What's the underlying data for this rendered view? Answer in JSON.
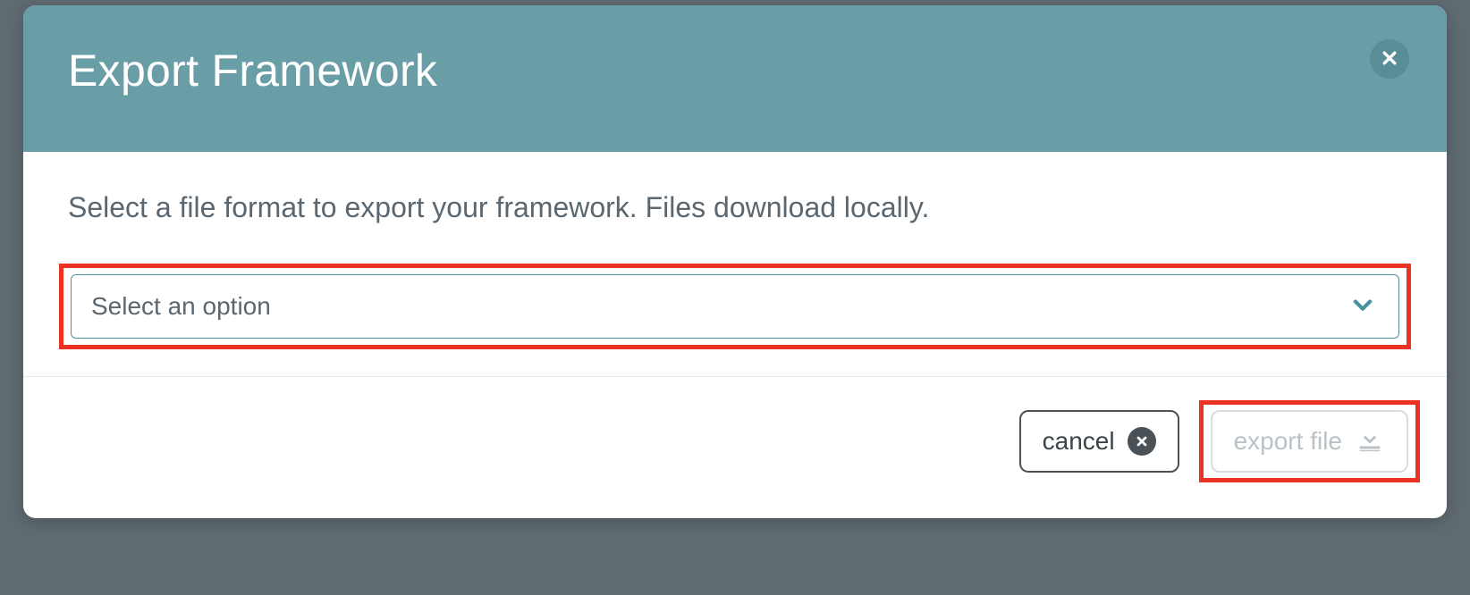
{
  "modal": {
    "title": "Export Framework",
    "body_text": "Select a file format to export your framework. Files download locally.",
    "select": {
      "placeholder": "Select an option"
    },
    "buttons": {
      "cancel_label": "cancel",
      "export_label": "export file"
    }
  },
  "colors": {
    "header_bg": "#6a9ea7",
    "accent": "#4a939e",
    "highlight": "#eb3223"
  }
}
